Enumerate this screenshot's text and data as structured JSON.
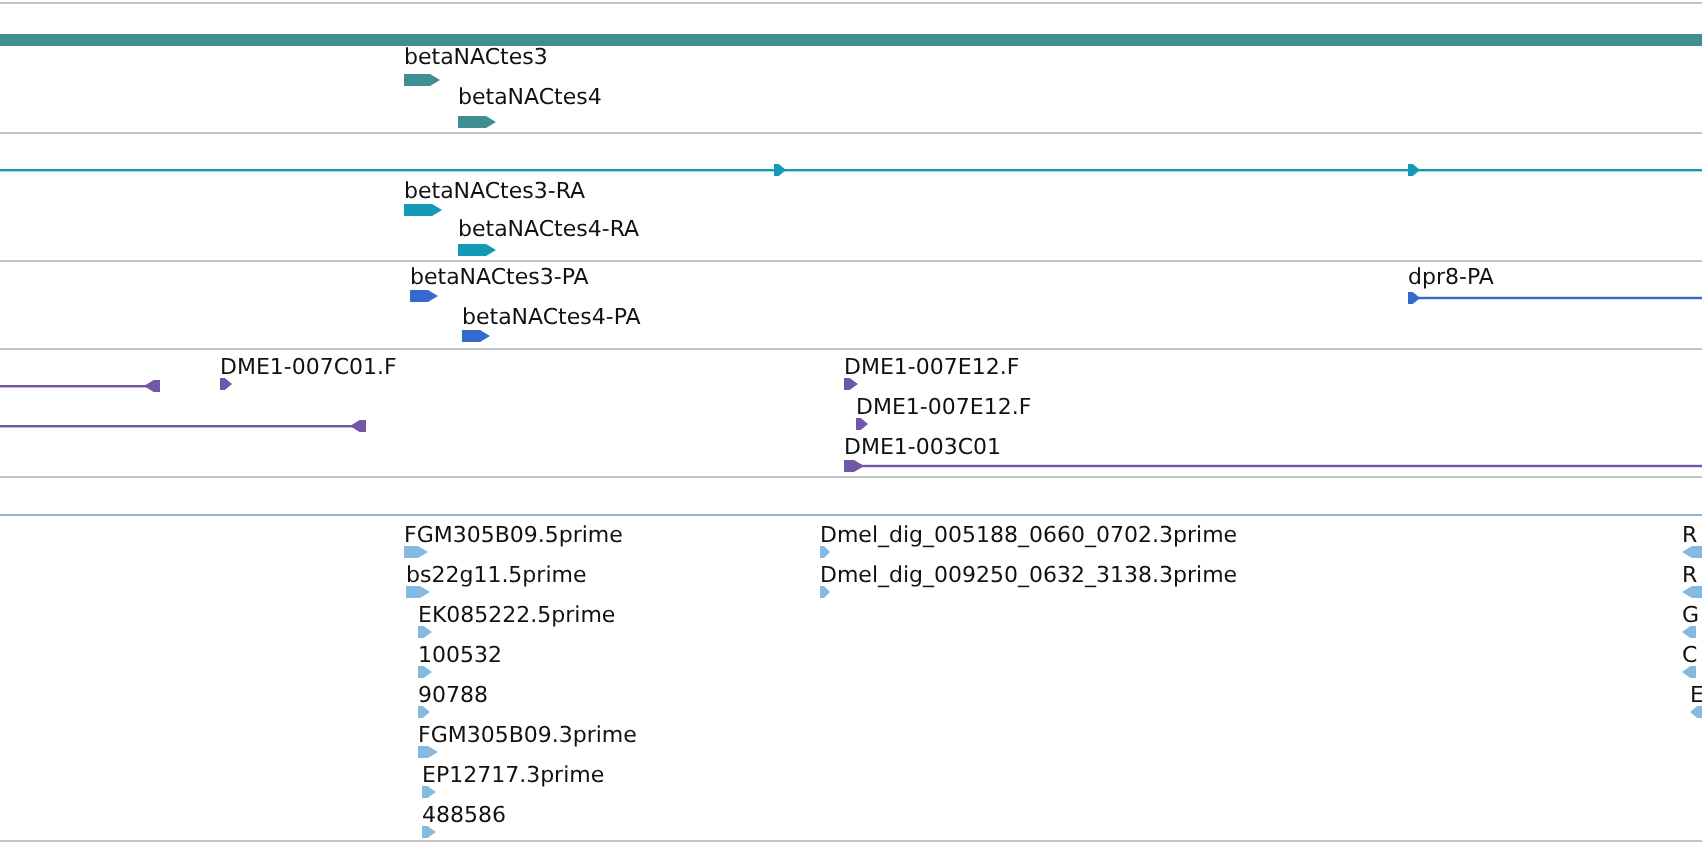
{
  "tracks": [
    {
      "features": [
        {
          "kind": "bar"
        },
        {
          "kind": "gene",
          "label": "betaNACtes3",
          "reverse": false
        },
        {
          "kind": "gene",
          "label": "betaNACtes4",
          "reverse": false
        }
      ]
    },
    {
      "features": [
        {
          "kind": "span",
          "reverse": false
        },
        {
          "kind": "gene",
          "label": "betaNACtes3-RA",
          "reverse": false
        },
        {
          "kind": "gene",
          "label": "betaNACtes4-RA",
          "reverse": false
        }
      ]
    },
    {
      "features": [
        {
          "kind": "gene",
          "label": "betaNACtes3-PA",
          "reverse": false
        },
        {
          "kind": "gene",
          "label": "betaNACtes4-PA",
          "reverse": false
        },
        {
          "kind": "transcript",
          "label": "dpr8-PA",
          "reverse": false
        }
      ]
    },
    {
      "features": [
        {
          "kind": "span",
          "reverse": true
        },
        {
          "kind": "gene",
          "label": "DME1-007C01.F",
          "reverse": false
        },
        {
          "kind": "span",
          "reverse": true
        },
        {
          "kind": "gene",
          "label": "DME1-007E12.F",
          "reverse": false
        },
        {
          "kind": "gene",
          "label": "DME1-007E12.F",
          "reverse": false
        },
        {
          "kind": "transcript",
          "label": "DME1-003C01",
          "reverse": false
        }
      ]
    },
    {
      "features": [
        {
          "kind": "gene",
          "label": "FGM305B09.5prime",
          "reverse": false
        },
        {
          "kind": "gene",
          "label": "bs22g11.5prime",
          "reverse": false
        },
        {
          "kind": "gene",
          "label": "EK085222.5prime",
          "reverse": false
        },
        {
          "kind": "gene",
          "label": "100532",
          "reverse": false
        },
        {
          "kind": "gene",
          "label": "90788",
          "reverse": false
        },
        {
          "kind": "gene",
          "label": "FGM305B09.3prime",
          "reverse": false
        },
        {
          "kind": "gene",
          "label": "EP12717.3prime",
          "reverse": false
        },
        {
          "kind": "gene",
          "label": "488586",
          "reverse": false
        },
        {
          "kind": "gene",
          "label": "Dmel_dig_005188_0660_0702.3prime",
          "reverse": false
        },
        {
          "kind": "gene",
          "label": "Dmel_dig_009250_0632_3138.3prime",
          "reverse": false
        },
        {
          "kind": "gene",
          "label": "R",
          "reverse": true
        },
        {
          "kind": "gene",
          "label": "R",
          "reverse": true
        },
        {
          "kind": "gene",
          "label": "G",
          "reverse": true
        },
        {
          "kind": "gene",
          "label": "C",
          "reverse": true
        },
        {
          "kind": "gene",
          "label": "E",
          "reverse": true
        }
      ]
    }
  ]
}
